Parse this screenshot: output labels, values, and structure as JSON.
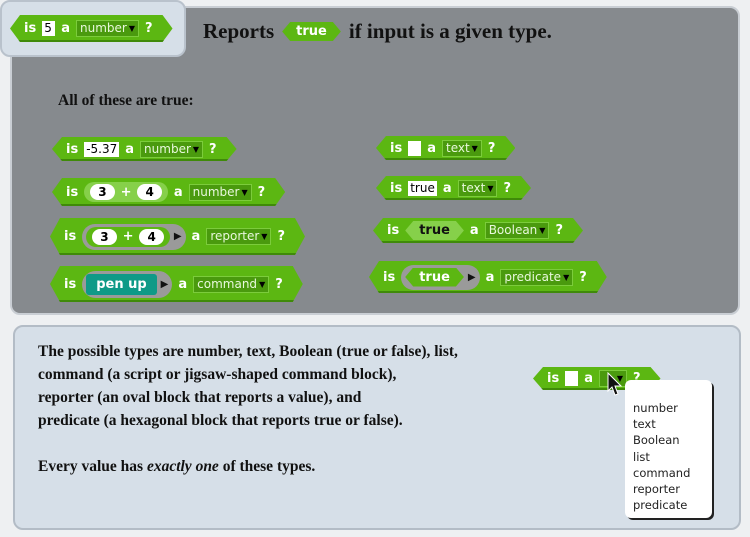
{
  "header": {
    "block": {
      "is": "is",
      "value": "5",
      "a": "a",
      "type": "number",
      "q": "?"
    },
    "title_pre": "Reports",
    "title_bool": "true",
    "title_post": "if input is a given type."
  },
  "subtitle": "All of these are true:",
  "examples": {
    "l1": {
      "is": "is",
      "value": "-5.37",
      "a": "a",
      "type": "number",
      "q": "?"
    },
    "l2": {
      "is": "is",
      "n1": "3",
      "op": "+",
      "n2": "4",
      "a": "a",
      "type": "number",
      "q": "?"
    },
    "l3": {
      "is": "is",
      "n1": "3",
      "op": "+",
      "n2": "4",
      "a": "a",
      "type": "reporter",
      "q": "?"
    },
    "l4": {
      "is": "is",
      "cmd": "pen up",
      "a": "a",
      "type": "command",
      "q": "?"
    },
    "r1": {
      "is": "is",
      "value": "",
      "a": "a",
      "type": "text",
      "q": "?"
    },
    "r2": {
      "is": "is",
      "value": "true",
      "a": "a",
      "type": "text",
      "q": "?"
    },
    "r3": {
      "is": "is",
      "bool": "true",
      "a": "a",
      "type": "Boolean",
      "q": "?"
    },
    "r4": {
      "is": "is",
      "bool": "true",
      "a": "a",
      "type": "predicate",
      "q": "?"
    }
  },
  "description": {
    "lines": [
      "The possible types are number, text, Boolean (true or false), list,",
      "command (a script or jigsaw-shaped command block),",
      "reporter (an oval block that reports a value), and",
      "predicate (a hexagonal block that reports true or false)."
    ],
    "note_pre": "Every value has ",
    "note_em": "exactly one",
    "note_post": " of these types."
  },
  "menu_block": {
    "is": "is",
    "a": "a",
    "q": "?"
  },
  "menu": [
    "number",
    "text",
    "Boolean",
    "list",
    "command",
    "reporter",
    "predicate"
  ],
  "colors": {
    "block_green": "#5cb712",
    "panel_gray": "#868a8e",
    "panel_blue": "#d6dfe8",
    "command_teal": "#0e9a87"
  }
}
